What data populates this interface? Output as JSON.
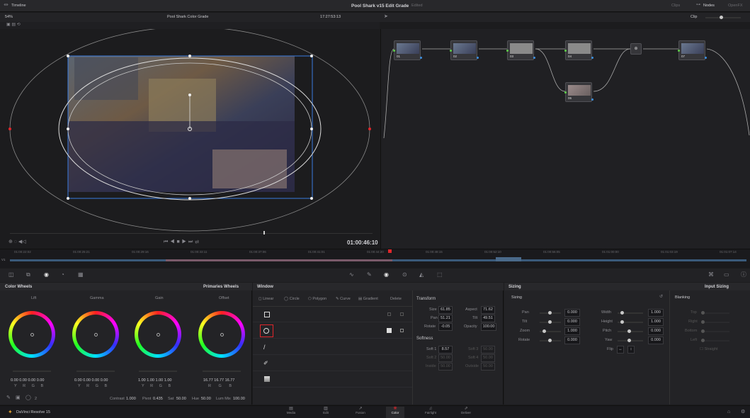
{
  "titlebar": {
    "left": "Timeline",
    "project": "Pool Shark v15 Edit Grade",
    "project_status": "Edited",
    "clips": "Clips",
    "nodes": "Nodes",
    "openfx": "OpenFX"
  },
  "viewer_bar": {
    "zoom": "54%",
    "clip_name": "Pool Shark Color Grade",
    "timecode": "17:27:53:13",
    "clip_mode": "Clip"
  },
  "transport": {
    "timecode": "01:00:46:10"
  },
  "timeline_ruler": [
    "01:00:22:02",
    "01:00:25:21",
    "01:00:29:16",
    "01:00:33:11",
    "01:00:37:06",
    "01:00:41:01",
    "01:00:44:20",
    "01:00:48:15",
    "01:00:52:10",
    "01:00:56:05",
    "01:01:00:00",
    "01:01:03:19",
    "01:01:07:14"
  ],
  "nodes": [
    {
      "label": "01"
    },
    {
      "label": "02"
    },
    {
      "label": "03"
    },
    {
      "label": "04"
    },
    {
      "label": "06"
    },
    {
      "label": "07"
    }
  ],
  "color_wheels": {
    "title": "Color Wheels",
    "mode": "Primaries Wheels",
    "wheels": [
      {
        "name": "Lift",
        "values": [
          "0.00",
          "0.00",
          "0.00",
          "0.00"
        ],
        "channels": [
          "Y",
          "R",
          "G",
          "B"
        ]
      },
      {
        "name": "Gamma",
        "values": [
          "0.00",
          "0.00",
          "0.00",
          "0.00"
        ],
        "channels": [
          "Y",
          "R",
          "G",
          "B"
        ]
      },
      {
        "name": "Gain",
        "values": [
          "1.00",
          "1.00",
          "1.00",
          "1.00"
        ],
        "channels": [
          "Y",
          "R",
          "G",
          "B"
        ]
      },
      {
        "name": "Offset",
        "values": [
          "16.77",
          "16.77",
          "16.77"
        ],
        "channels": [
          "R",
          "G",
          "B"
        ]
      }
    ],
    "page": "2",
    "bottom": {
      "contrast_label": "Contrast",
      "contrast": "1.000",
      "pivot_label": "Pivot",
      "pivot": "0.435",
      "sat_label": "Sat",
      "sat": "50.00",
      "hue_label": "Hue",
      "hue": "50.00",
      "lummix_label": "Lum Mix",
      "lummix": "100.00"
    }
  },
  "window": {
    "title": "Window",
    "tools": [
      "Linear",
      "Circle",
      "Polygon",
      "Curve",
      "Gradient"
    ],
    "delete": "Delete"
  },
  "transform": {
    "title": "Transform",
    "size_label": "Size",
    "size": "61.85",
    "aspect_label": "Aspect",
    "aspect": "71.62",
    "pan_label": "Pan",
    "pan": "51.21",
    "tilt_label": "Tilt",
    "tilt": "49.51",
    "rotate_label": "Rotate",
    "rotate": "-0.05",
    "opacity_label": "Opacity",
    "opacity": "100.00"
  },
  "softness": {
    "title": "Softness",
    "soft1_label": "Soft 1",
    "soft1": "8.57",
    "soft3_label": "Soft 3",
    "soft3": "50.00",
    "soft2_label": "Soft 2",
    "soft2": "50.00",
    "soft4_label": "Soft 4",
    "soft4": "50.00",
    "inside_label": "Inside",
    "inside": "50.00",
    "outside_label": "Outside",
    "outside": "50.00"
  },
  "sizing": {
    "title": "Sizing",
    "subtitle": "Sizing",
    "mode": "Input Sizing",
    "left": [
      {
        "label": "Pan",
        "value": "0.000"
      },
      {
        "label": "Tilt",
        "value": "0.000"
      },
      {
        "label": "Zoom",
        "value": "1.000"
      },
      {
        "label": "Rotate",
        "value": "0.000"
      }
    ],
    "right": [
      {
        "label": "Width",
        "value": "1.000"
      },
      {
        "label": "Height",
        "value": "1.000"
      },
      {
        "label": "Pitch",
        "value": "0.000"
      },
      {
        "label": "Yaw",
        "value": "0.000"
      }
    ],
    "flip": "Flip"
  },
  "blanking": {
    "title": "Blanking",
    "items": [
      "Top",
      "Right",
      "Bottom",
      "Left"
    ],
    "straight": "Straight"
  },
  "pages": [
    {
      "label": "Media"
    },
    {
      "label": "Edit"
    },
    {
      "label": "Fusion"
    },
    {
      "label": "Color"
    },
    {
      "label": "Fairlight"
    },
    {
      "label": "Deliver"
    }
  ],
  "app_name": "DaVinci Resolve 15",
  "accent": "#e0262b",
  "node_link_color": "#5fd04a"
}
